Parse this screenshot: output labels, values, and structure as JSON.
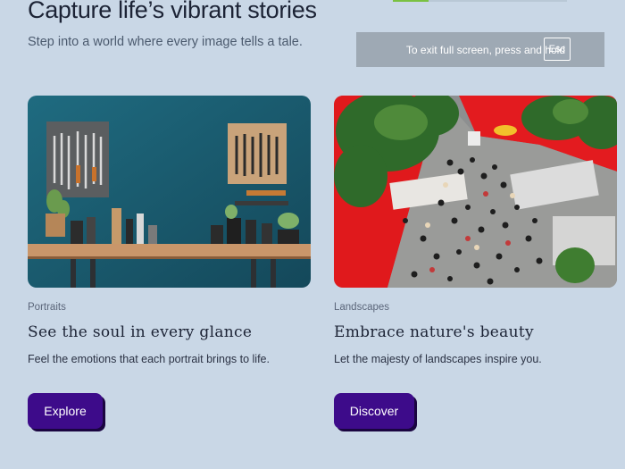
{
  "hero": {
    "title": "Capture life’s vibrant stories",
    "subtitle": "Step into a world where every image tells a tale."
  },
  "fullscreen_toast": {
    "message": "To exit full screen, press and hold",
    "key": "Esc"
  },
  "cards": [
    {
      "category": "Portraits",
      "title": "See the soul in every glance",
      "description": "Feel the emotions that each portrait brings to life.",
      "button_label": "Explore",
      "image_subject": "workshop tools on teal wall"
    },
    {
      "category": "Landscapes",
      "title": "Embrace nature's beauty",
      "description": "Let the majesty of landscapes inspire you.",
      "button_label": "Discover",
      "image_subject": "crowd at food trucks aerial view"
    }
  ],
  "colors": {
    "background": "#c9d7e6",
    "button": "#3d0b8a",
    "toast": "#9ea9b4"
  }
}
